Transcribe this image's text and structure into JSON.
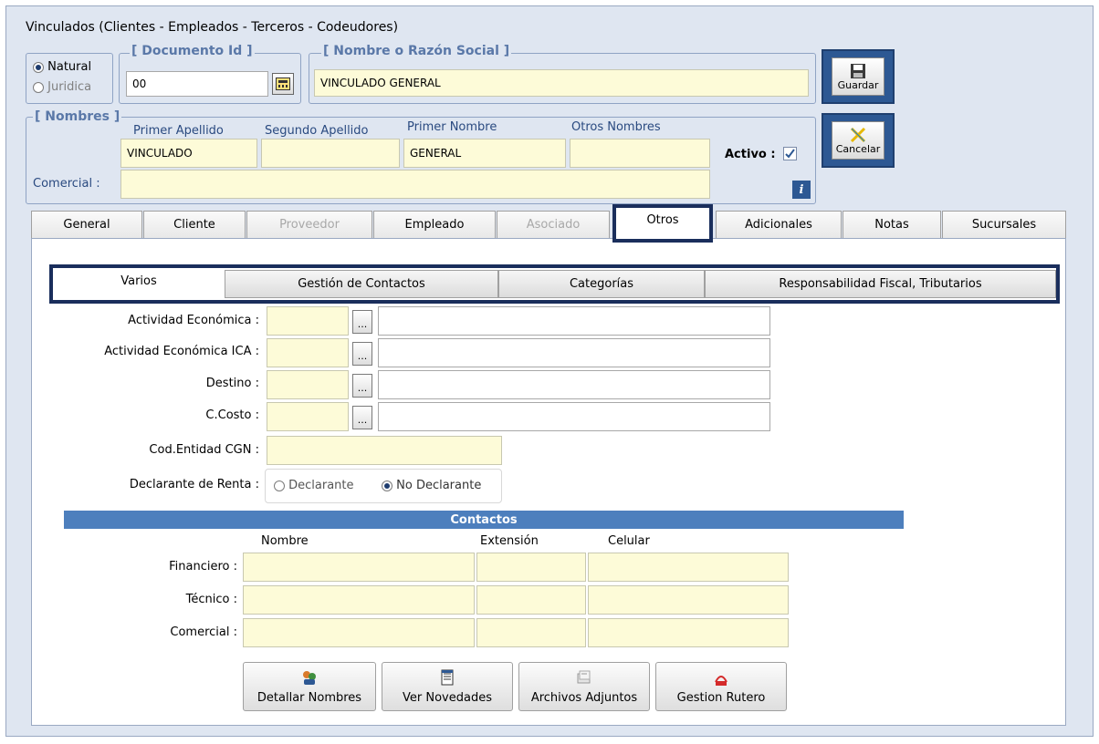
{
  "window": {
    "title": "Vinculados   (Clientes - Empleados - Terceros - Codeudores)"
  },
  "tipo": {
    "natural": "Natural",
    "juridica": "Juridica",
    "selected": "Natural"
  },
  "documento": {
    "group_label": "[ Documento Id ]",
    "value": "00"
  },
  "razon_social": {
    "group_label": "[ Nombre o Razón Social ]",
    "value": "VINCULADO GENERAL"
  },
  "nombres": {
    "group_label": "[ Nombres ]",
    "primer_apellido_label": "Primer Apellido",
    "segundo_apellido_label": "Segundo Apellido",
    "primer_nombre_label": "Primer Nombre",
    "otros_nombres_label": "Otros Nombres",
    "primer_apellido": "VINCULADO",
    "segundo_apellido": "",
    "primer_nombre": "GENERAL",
    "otros_nombres": "",
    "comercial_label": "Comercial :",
    "comercial": "",
    "activo_label": "Activo :",
    "activo_checked": true
  },
  "buttons": {
    "guardar": "Guardar",
    "cancelar": "Cancelar"
  },
  "tabs": [
    {
      "label": "General",
      "enabled": true
    },
    {
      "label": "Cliente",
      "enabled": true
    },
    {
      "label": "Proveedor",
      "enabled": false
    },
    {
      "label": "Empleado",
      "enabled": true
    },
    {
      "label": "Asociado",
      "enabled": false
    },
    {
      "label": "Otros",
      "enabled": true,
      "active": true
    },
    {
      "label": "Adicionales",
      "enabled": true
    },
    {
      "label": "Notas",
      "enabled": true
    },
    {
      "label": "Sucursales",
      "enabled": true
    }
  ],
  "subtabs": [
    "Varios",
    "Gestión de Contactos",
    "Categorías",
    "Responsabilidad Fiscal, Tributarios"
  ],
  "varios": {
    "actividad_economica": "Actividad Económica :",
    "actividad_economica_ica": "Actividad Económica ICA :",
    "destino": "Destino :",
    "ccosto": "C.Costo :",
    "cod_entidad": "Cod.Entidad CGN :",
    "declarante_renta": "Declarante de Renta :",
    "declarante": "Declarante",
    "no_declarante": "No Declarante",
    "selected": "No Declarante",
    "dots": "..."
  },
  "contactos": {
    "header": "Contactos",
    "col_nombre": "Nombre",
    "col_extension": "Extensión",
    "col_celular": "Celular",
    "rows": [
      "Financiero :",
      "Técnico :",
      "Comercial :"
    ]
  },
  "bottom_buttons": [
    "Detallar Nombres",
    "Ver Novedades",
    "Archivos Adjuntos",
    "Gestion Rutero"
  ],
  "colors": {
    "accent": "#1a2e5c",
    "field": "#fdfbd8",
    "header_bar": "#4d7fbd"
  }
}
